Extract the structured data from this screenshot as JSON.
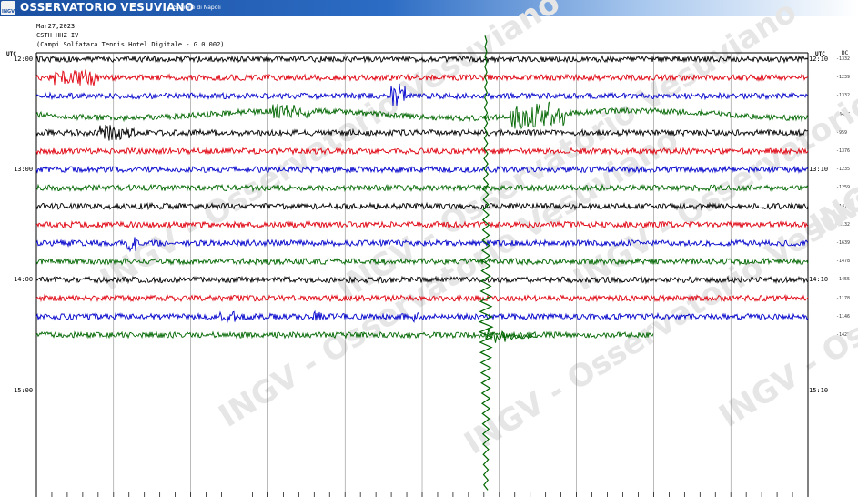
{
  "header": {
    "title": "OSSERVATORIO VESUVIANO",
    "subtitle": "Sezione di Napoli",
    "logo_text": "INGV"
  },
  "info": {
    "date": "Mar27,2023",
    "station": "CSTH HHZ IV",
    "description": "(Campi Solfatara Tennis Hotel Digitale - G 0.002)"
  },
  "corner_left": "UTC",
  "corner_right": "UTC",
  "unit_label": "DC",
  "time_labels_left": [
    "12:00",
    "13:00",
    "14:00",
    "15:00"
  ],
  "time_labels_right": [
    "12:10",
    "13:10",
    "14:10",
    "15:10"
  ],
  "amplitude_labels": [
    "-1332",
    "-1239",
    "-1332",
    "-4407",
    "-959",
    "-1376",
    "-1235",
    "-1259",
    "-1475",
    "-1132",
    "-1639",
    "-1478",
    "-1455",
    "-1178",
    "-1146",
    "-1428"
  ],
  "trace_colors": [
    "#000000",
    "#e0000e",
    "#0000cc",
    "#006600"
  ],
  "watermark": "INGV - Osservatorio Vesuviano"
}
